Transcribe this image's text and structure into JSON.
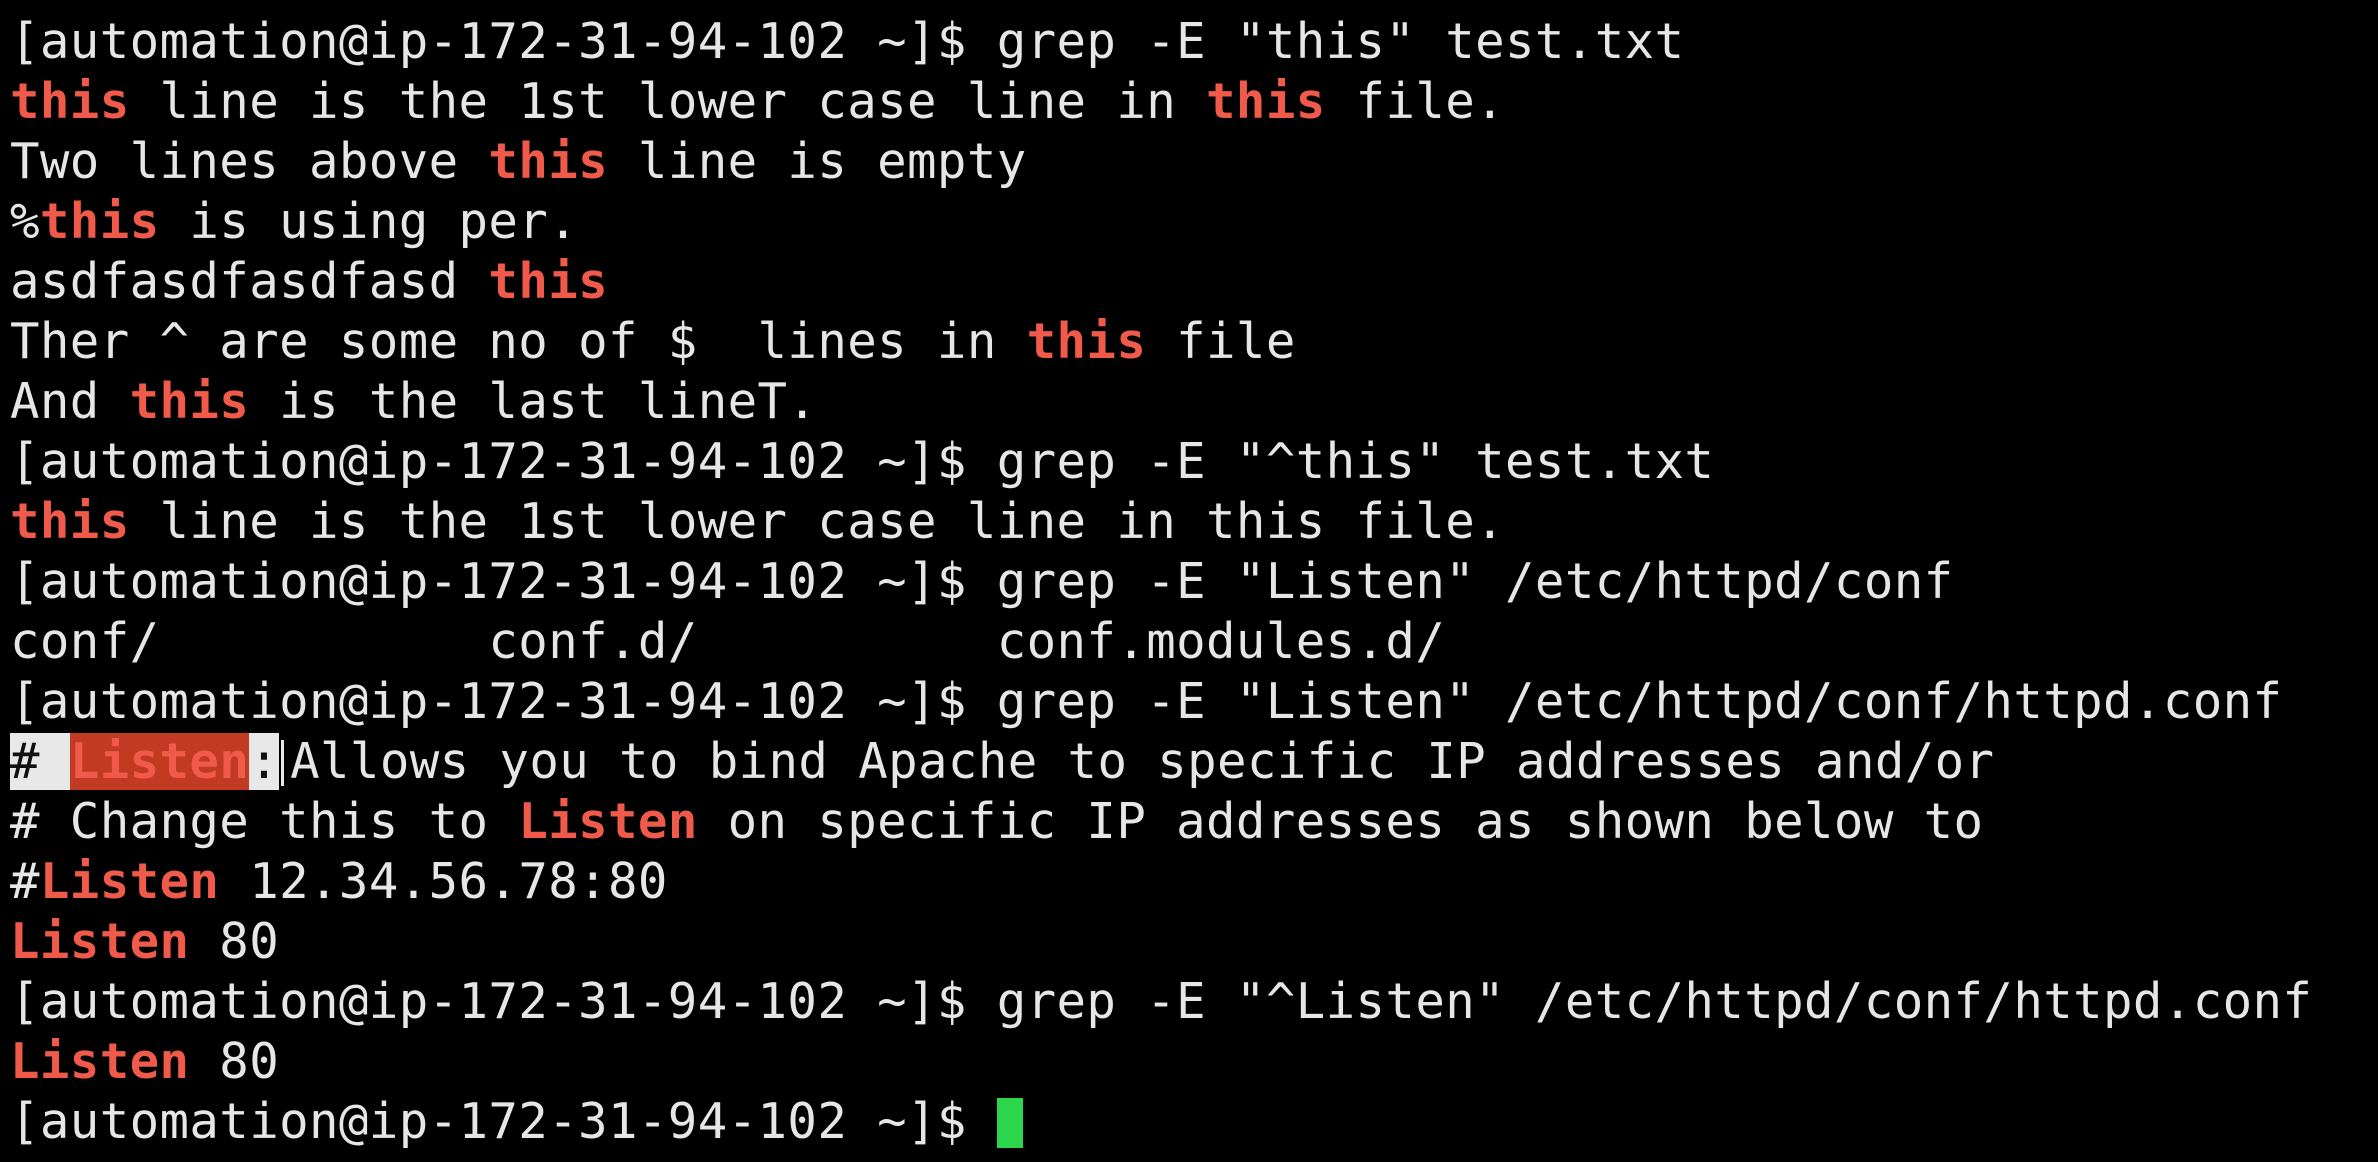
{
  "terminal": {
    "prompt": "[automation@ip-172-31-94-102 ~]$ ",
    "cursor_color": "#2bd64a",
    "highlight_color": "#ef5a4a",
    "lines": [
      [
        {
          "t": "[automation@ip-172-31-94-102 ~]$ grep -E \"this\" test.txt"
        }
      ],
      [
        {
          "t": "this",
          "s": "hl"
        },
        {
          "t": " line is the 1st lower case line in "
        },
        {
          "t": "this",
          "s": "hl"
        },
        {
          "t": " file."
        }
      ],
      [
        {
          "t": "Two lines above "
        },
        {
          "t": "this",
          "s": "hl"
        },
        {
          "t": " line is empty"
        }
      ],
      [
        {
          "t": "%"
        },
        {
          "t": "this",
          "s": "hl"
        },
        {
          "t": " is using per."
        }
      ],
      [
        {
          "t": "asdfasdfasdfasd "
        },
        {
          "t": "this",
          "s": "hl"
        }
      ],
      [
        {
          "t": "Ther ^ are some no of $  lines in "
        },
        {
          "t": "this",
          "s": "hl"
        },
        {
          "t": " file"
        }
      ],
      [
        {
          "t": "And "
        },
        {
          "t": "this",
          "s": "hl"
        },
        {
          "t": " is the last lineT."
        }
      ],
      [
        {
          "t": "[automation@ip-172-31-94-102 ~]$ grep -E \"^this\" test.txt"
        }
      ],
      [
        {
          "t": "this",
          "s": "hl"
        },
        {
          "t": " line is the 1st lower case line in this file."
        }
      ],
      [
        {
          "t": "[automation@ip-172-31-94-102 ~]$ grep -E \"Listen\" /etc/httpd/conf"
        }
      ],
      [
        {
          "t": "conf/           conf.d/          conf.modules.d/"
        }
      ],
      [
        {
          "t": "[automation@ip-172-31-94-102 ~]$ grep -E \"Listen\" /etc/httpd/conf/httpd.conf"
        }
      ],
      [
        {
          "t": "# ",
          "s": "sel"
        },
        {
          "t": "Listen",
          "s": "selhl"
        },
        {
          "t": ":",
          "s": "sel"
        },
        {
          "t": "",
          "s": "caret"
        },
        {
          "t": "Allows you to bind Apache to specific IP addresses and/or"
        }
      ],
      [
        {
          "t": "# Change this to "
        },
        {
          "t": "Listen",
          "s": "hl"
        },
        {
          "t": " on specific IP addresses as shown below to"
        }
      ],
      [
        {
          "t": "#"
        },
        {
          "t": "Listen",
          "s": "hl"
        },
        {
          "t": " 12.34.56.78:80"
        }
      ],
      [
        {
          "t": "Listen",
          "s": "hl"
        },
        {
          "t": " 80"
        }
      ],
      [
        {
          "t": "[automation@ip-172-31-94-102 ~]$ grep -E \"^Listen\" /etc/httpd/conf/httpd.conf"
        }
      ],
      [
        {
          "t": "Listen",
          "s": "hl"
        },
        {
          "t": " 80"
        }
      ]
    ]
  }
}
